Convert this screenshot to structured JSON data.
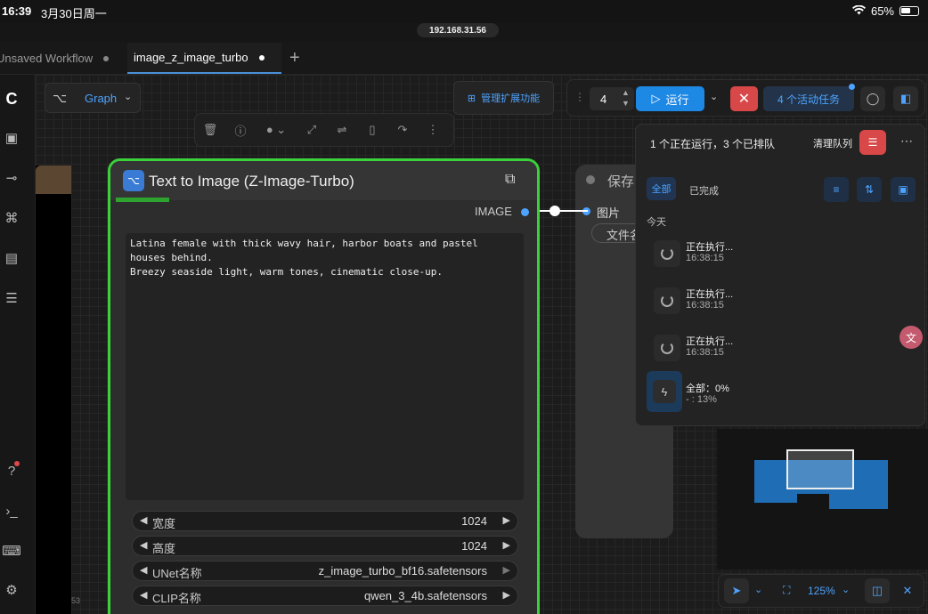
{
  "status_bar": {
    "time": "16:39",
    "date": "3月30日周一",
    "battery": "65%"
  },
  "browser": {
    "url": "192.168.31.56"
  },
  "tabs": [
    {
      "label": "Unsaved Workflow"
    },
    {
      "label": "image_z_image_turbo"
    }
  ],
  "sidebar": {
    "bottom_label": "53"
  },
  "toolbar": {
    "graph_label": "Graph",
    "extensions_label": "管理扩展功能",
    "queue_count": "4",
    "run_label": "运行",
    "active_tasks_label": "4 个活动任务"
  },
  "node": {
    "title": "Text to Image (Z-Image-Turbo)",
    "output_label": "IMAGE",
    "prompt": "Latina female with thick wavy hair, harbor boats and pastel houses behind.\nBreezy seaside light, warm tones, cinematic close-up.",
    "widgets": [
      {
        "name": "宽度",
        "value": "1024"
      },
      {
        "name": "高度",
        "value": "1024"
      },
      {
        "name": "UNet名称",
        "value": "z_image_turbo_bf16.safetensors"
      },
      {
        "name": "CLIP名称",
        "value": "qwen_3_4b.safetensors"
      }
    ]
  },
  "save_node": {
    "title": "保存",
    "input_label": "图片",
    "field_label": "文件名"
  },
  "queue": {
    "summary": "1 个正在运行，3 个已排队",
    "clear_label": "清理队列",
    "tab_all": "全部",
    "tab_done": "已完成",
    "today_label": "今天",
    "items": [
      {
        "status": "正在执行...",
        "time": "16:38:15"
      },
      {
        "status": "正在执行...",
        "time": "16:38:15"
      },
      {
        "status": "正在执行...",
        "time": "16:38:15"
      }
    ],
    "total_label": "全部：0%",
    "total_sub": "- : 13%"
  },
  "bottom_toolbar": {
    "zoom": "125%"
  },
  "colors": {
    "accent": "#1e88e5",
    "node_border": "#3ad13a",
    "stop": "#d94848"
  }
}
